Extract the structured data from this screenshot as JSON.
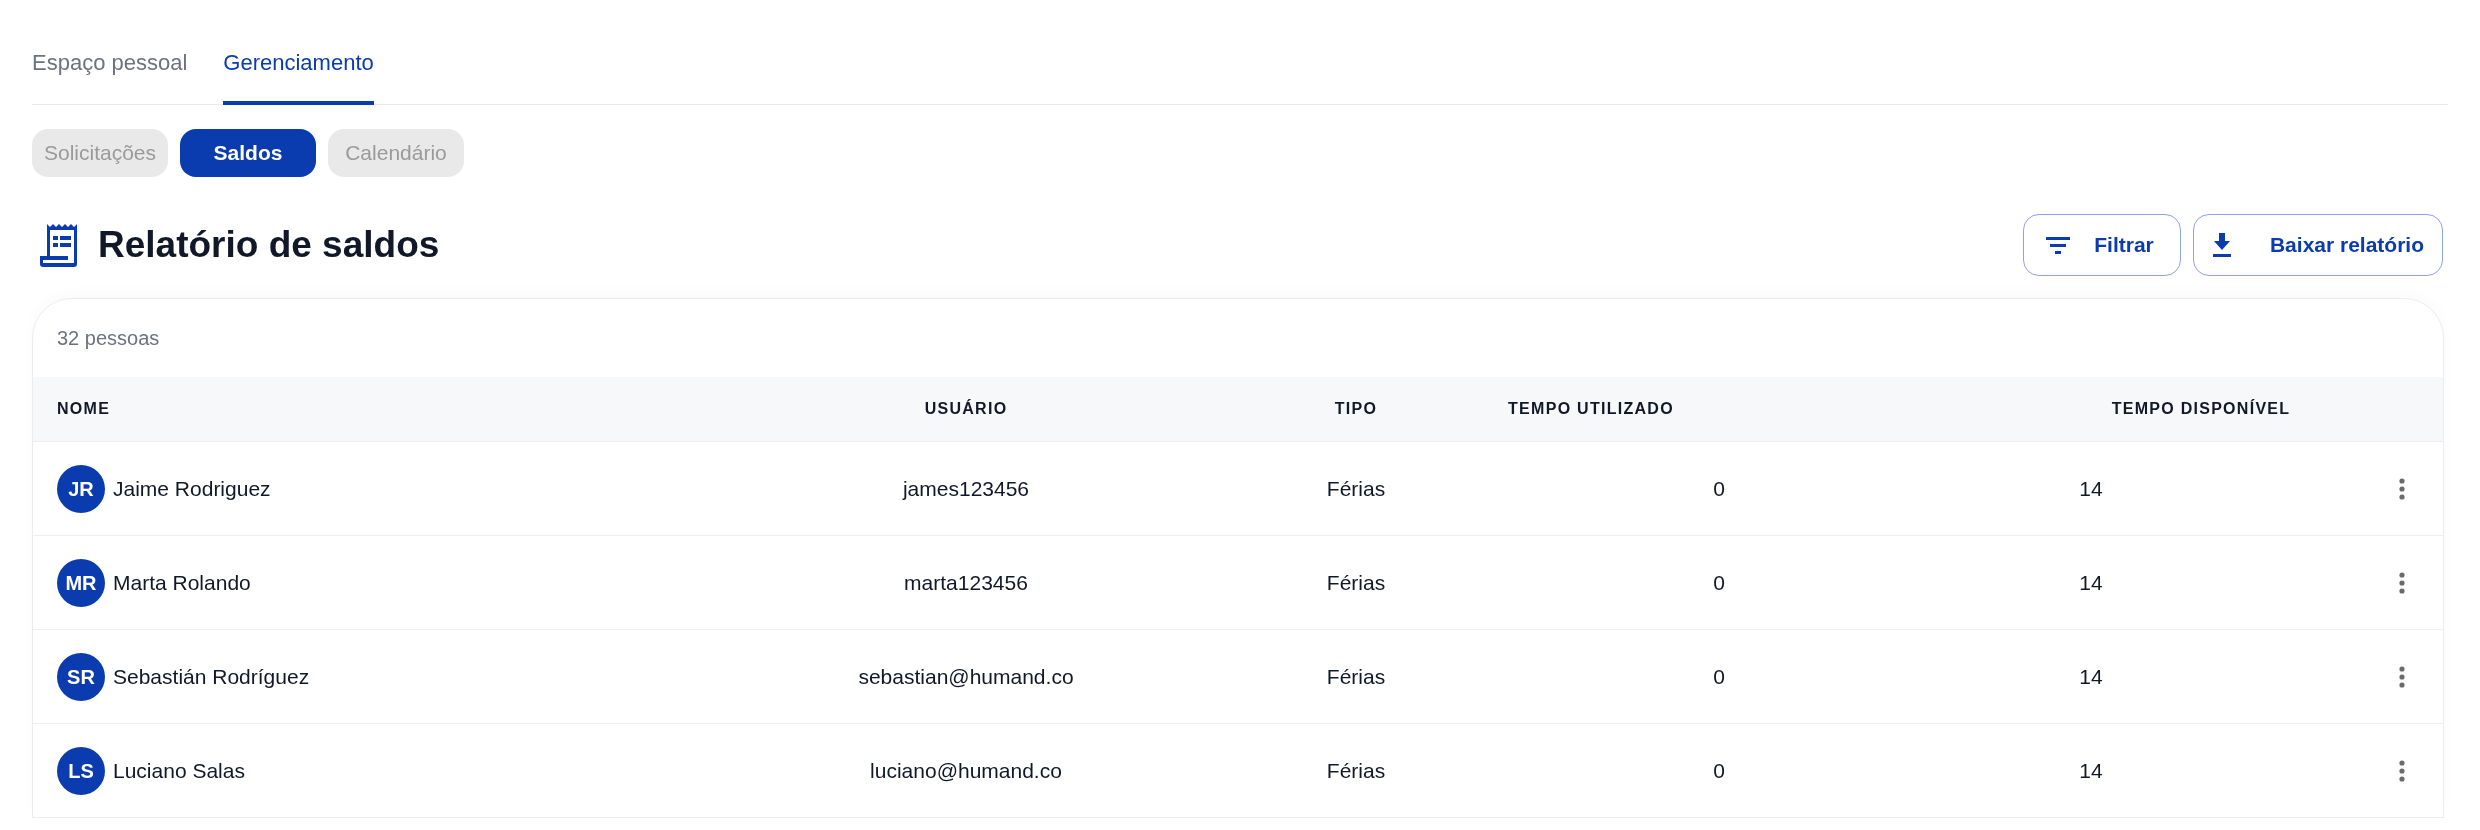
{
  "tabs": [
    {
      "label": "Espaço pessoal",
      "selected": false
    },
    {
      "label": "Gerenciamento",
      "selected": true
    }
  ],
  "subtabs": [
    {
      "label": "Solicitações",
      "selected": false
    },
    {
      "label": "Saldos",
      "selected": true
    },
    {
      "label": "Calendário",
      "selected": false
    }
  ],
  "page_title": "Relatório de saldos",
  "actions": [
    {
      "kind": "filter",
      "label": "Filtrar"
    },
    {
      "kind": "download",
      "label": "Baixar relatório"
    }
  ],
  "table": {
    "count": "32 pessoas",
    "columns": [
      "NOME",
      "USUÁRIO",
      "TIPO",
      "TEMPO UTILIZADO",
      "TEMPO DISPONÍVEL"
    ],
    "rows": [
      {
        "initials": "JR",
        "name": "Jaime Rodriguez",
        "user": "james123456",
        "type": "Férias",
        "used": "0",
        "available": "14"
      },
      {
        "initials": "MR",
        "name": "Marta Rolando",
        "user": "marta123456",
        "type": "Férias",
        "used": "0",
        "available": "14"
      },
      {
        "initials": "SR",
        "name": "Sebastián Rodríguez",
        "user": "sebastian@humand.co",
        "type": "Férias",
        "used": "0",
        "available": "14"
      },
      {
        "initials": "LS",
        "name": "Luciano Salas",
        "user": "luciano@humand.co",
        "type": "Férias",
        "used": "0",
        "available": "14"
      }
    ]
  }
}
